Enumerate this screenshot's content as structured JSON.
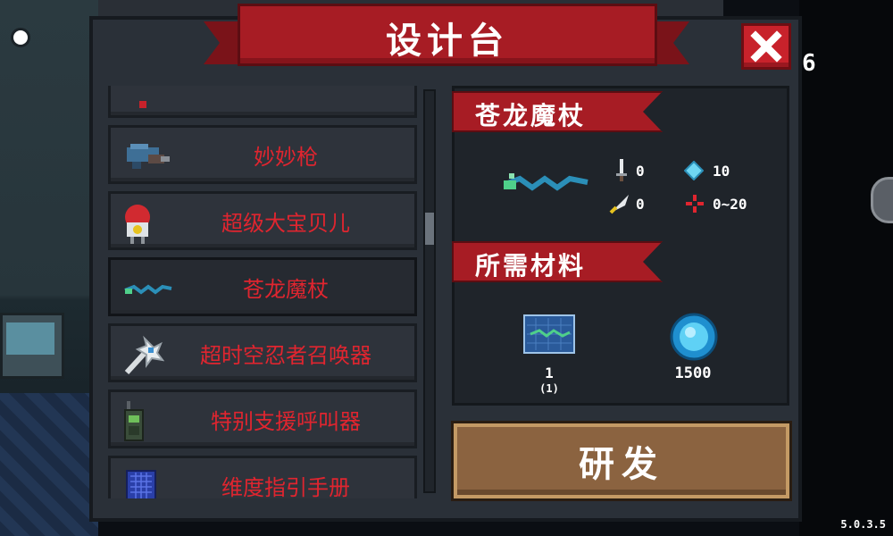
{
  "window": {
    "title": "设计台",
    "close_icon": "close-icon"
  },
  "hud": {
    "counter": "6",
    "version": "5.0.3.5"
  },
  "list": {
    "items": [
      {
        "label": "",
        "icon": "partial-item-icon"
      },
      {
        "label": "妙妙枪",
        "icon": "gun-icon"
      },
      {
        "label": "超级大宝贝儿",
        "icon": "bomb-robot-icon"
      },
      {
        "label": "苍龙魔杖",
        "icon": "dragon-staff-icon",
        "selected": true
      },
      {
        "label": "超时空忍者召唤器",
        "icon": "summoner-staff-icon"
      },
      {
        "label": "特别支援呼叫器",
        "icon": "walkie-talkie-icon"
      },
      {
        "label": "维度指引手册",
        "icon": "manual-icon"
      }
    ]
  },
  "detail": {
    "name": "苍龙魔杖",
    "stats": {
      "damage": "0",
      "energy": "10",
      "crit": "0",
      "spread": "0~20"
    },
    "materials_title": "所需材料",
    "materials": [
      {
        "icon": "blueprint-icon",
        "amount": "1",
        "owned": "(1)"
      },
      {
        "icon": "gem-icon",
        "amount": "1500"
      }
    ]
  },
  "actions": {
    "research_label": "研发"
  },
  "colors": {
    "accent_red": "#a71c24",
    "label_red": "#e0252f",
    "button_brown": "#8b6340",
    "panel": "#2a3038"
  }
}
